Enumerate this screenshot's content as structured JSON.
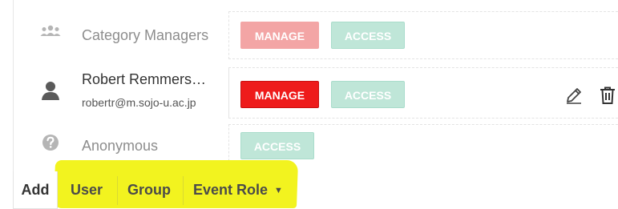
{
  "rows": [
    {
      "label": "Category Managers",
      "icon": "group-icon",
      "buttons": {
        "manage": "MANAGE",
        "access": "ACCESS"
      }
    },
    {
      "name": "Robert Remmers…",
      "email": "robertr@m.sojo-u.ac.jp",
      "icon": "user-icon",
      "buttons": {
        "manage": "MANAGE",
        "access": "ACCESS"
      }
    },
    {
      "label": "Anonymous",
      "icon": "question-icon",
      "buttons": {
        "access": "ACCESS"
      }
    }
  ],
  "bottom": {
    "add": "Add",
    "user": "User",
    "group": "Group",
    "event_role": "Event Role"
  },
  "colors": {
    "manage_active": "#ee1b1b",
    "manage_faded": "#f3a5a5",
    "access_faded": "#bfe6d8",
    "highlight": "#f2f31f"
  }
}
